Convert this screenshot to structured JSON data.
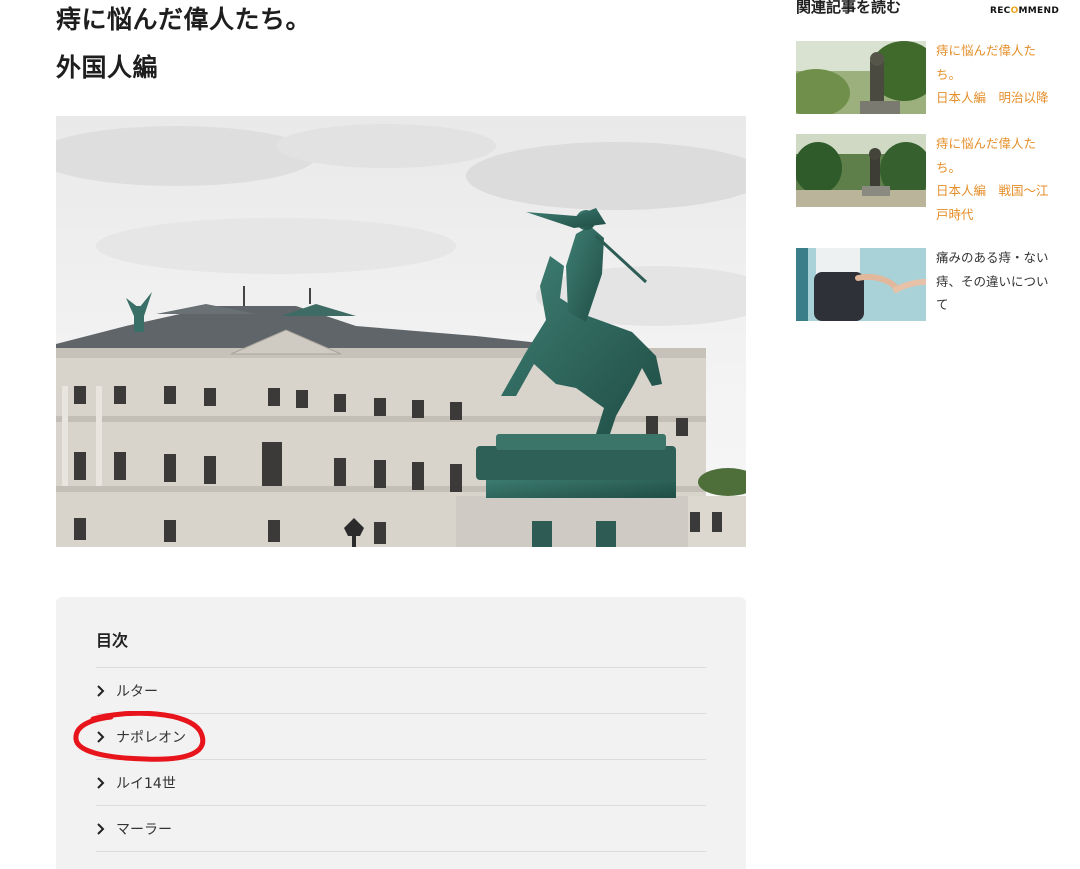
{
  "article": {
    "title_line1": "痔に悩んだ偉人たち。",
    "title_line2": "外国人編"
  },
  "toc": {
    "heading": "目次",
    "items": [
      "ルター",
      "ナポレオン",
      "ルイ14世",
      "マーラー"
    ]
  },
  "sidebar": {
    "heading": "関連記事を読む",
    "badge_pre": "REC",
    "badge_o": "O",
    "badge_post": "MMEND",
    "cards": [
      {
        "lines": [
          "痔に悩んだ偉人た",
          "ち。",
          "日本人編　明治以降"
        ]
      },
      {
        "lines": [
          "痔に悩んだ偉人た",
          "ち。",
          "日本人編　戦国〜江",
          "戸時代"
        ]
      },
      {
        "lines": [
          "痛みのある痔・ない",
          "痔、その違いについ",
          "て"
        ]
      }
    ]
  },
  "colors": {
    "accent": "#e58f2a",
    "highlight": "#e8141c",
    "toc_bg": "#f2f2f2"
  }
}
